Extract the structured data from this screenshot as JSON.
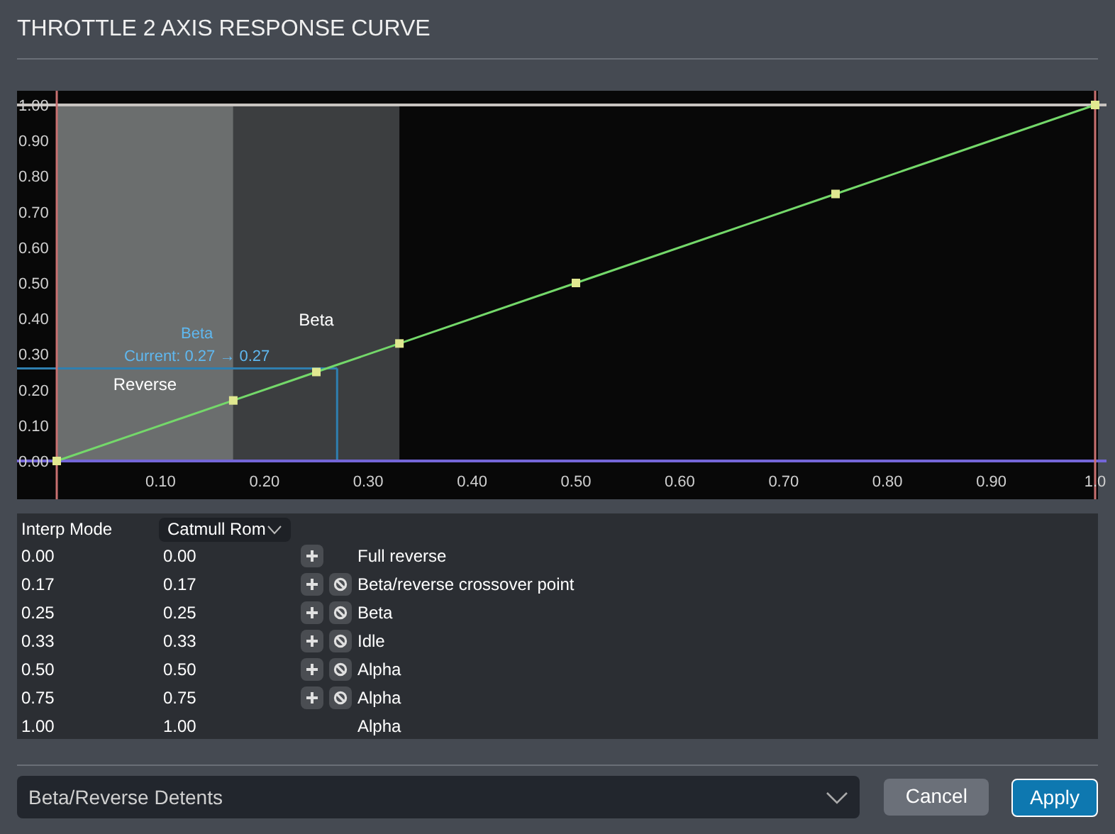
{
  "title": "THROTTLE 2 AXIS RESPONSE CURVE",
  "chart": {
    "chart_data": {
      "type": "line",
      "x": [
        0,
        0.17,
        0.25,
        0.33,
        0.5,
        0.75,
        1
      ],
      "series": [
        {
          "color": "#74d86a",
          "marker": "square",
          "values": [
            0,
            0.17,
            0.25,
            0.33,
            0.5,
            0.75,
            1
          ]
        }
      ],
      "xlim": [
        0,
        1
      ],
      "ylim": [
        0,
        1
      ],
      "xticks": [
        {
          "value": 0.1,
          "label": "0.10"
        },
        {
          "value": 0.2,
          "label": "0.20"
        },
        {
          "value": 0.3,
          "label": "0.30"
        },
        {
          "value": 0.4,
          "label": "0.40"
        },
        {
          "value": 0.5,
          "label": "0.50"
        },
        {
          "value": 0.6,
          "label": "0.60"
        },
        {
          "value": 0.7,
          "label": "0.70"
        },
        {
          "value": 0.8,
          "label": "0.80"
        },
        {
          "value": 0.9,
          "label": "0.90"
        },
        {
          "value": 1,
          "label": "1.0"
        }
      ],
      "yticks": [
        {
          "value": 0,
          "label": "0.00"
        },
        {
          "value": 0.1,
          "label": "0.10"
        },
        {
          "value": 0.2,
          "label": "0.20"
        },
        {
          "value": 0.3,
          "label": "0.30"
        },
        {
          "value": 0.4,
          "label": "0.40"
        },
        {
          "value": 0.5,
          "label": "0.50"
        },
        {
          "value": 0.6,
          "label": "0.60"
        },
        {
          "value": 0.7,
          "label": "0.70"
        },
        {
          "value": 0.8,
          "label": "0.80"
        },
        {
          "value": 0.9,
          "label": "0.90"
        },
        {
          "value": 1,
          "label": "1.00"
        }
      ],
      "bands": [
        {
          "axis": "x",
          "from": 0,
          "to": 0.17,
          "label": "Reverse"
        },
        {
          "axis": "x",
          "from": 0.17,
          "to": 0.33,
          "label": "Beta"
        }
      ],
      "ref_lines": [
        {
          "axis": "y",
          "value": 0.26
        },
        {
          "axis": "x",
          "value": 0.27
        }
      ],
      "annotations": [
        "Beta",
        "Current: 0.27 → 0.27"
      ]
    }
  },
  "table": {
    "header": {
      "label": "Interp Mode",
      "mode": "Catmull Rom"
    },
    "rows": [
      {
        "input": "0.00",
        "output": "0.00",
        "add": true,
        "remove": false,
        "label": "Full reverse"
      },
      {
        "input": "0.17",
        "output": "0.17",
        "add": true,
        "remove": true,
        "label": "Beta/reverse crossover point"
      },
      {
        "input": "0.25",
        "output": "0.25",
        "add": true,
        "remove": true,
        "label": "Beta"
      },
      {
        "input": "0.33",
        "output": "0.33",
        "add": true,
        "remove": true,
        "label": "Idle"
      },
      {
        "input": "0.50",
        "output": "0.50",
        "add": true,
        "remove": true,
        "label": "Alpha"
      },
      {
        "input": "0.75",
        "output": "0.75",
        "add": true,
        "remove": true,
        "label": "Alpha"
      },
      {
        "input": "1.00",
        "output": "1.00",
        "add": false,
        "remove": false,
        "label": "Alpha"
      }
    ]
  },
  "footer": {
    "preset": "Beta/Reverse Detents",
    "buttons": [
      {
        "label": "Cancel",
        "kind": "secondary"
      },
      {
        "label": "Apply",
        "kind": "primary"
      }
    ]
  }
}
